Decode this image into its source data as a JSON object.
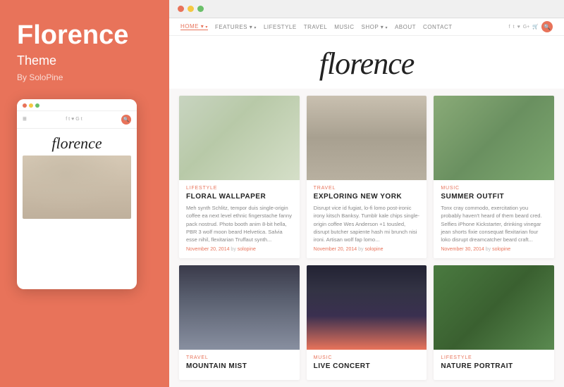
{
  "left": {
    "title": "Florence",
    "subtitle": "Theme",
    "byline": "By SoloPine",
    "logo_text": "florence"
  },
  "browser": {
    "dots": [
      "red",
      "yellow",
      "green"
    ]
  },
  "nav": {
    "links": [
      {
        "label": "HOME",
        "active": true,
        "has_arrow": true
      },
      {
        "label": "FEATURES",
        "has_arrow": true
      },
      {
        "label": "LIFESTYLE"
      },
      {
        "label": "TRAVEL"
      },
      {
        "label": "MUSIC"
      },
      {
        "label": "SHOP",
        "has_arrow": true
      },
      {
        "label": "ABOUT"
      },
      {
        "label": "CONTACT"
      }
    ]
  },
  "site_logo": "florence",
  "cards": [
    {
      "category": "LIFESTYLE",
      "category_class": "cat-lifestyle",
      "title": "FLORAL WALLPAPER",
      "text": "Meh synth Schlitz, tempor duis single-origin coffee ea next level ethnic fingerstache fanny pack nostrud. Photo booth anim 8-bit hella, PBR 3 wolf moon beard Helvetica. Salvia esse nihil, flexitarian Truffaut synth...",
      "date": "November 20, 2014",
      "author": "solopine",
      "img_class": "card-img-1"
    },
    {
      "category": "TRAVEL",
      "category_class": "cat-travel",
      "title": "EXPLORING NEW YORK",
      "text": "Disrupt vice id fugiat, lo-fi lomo post-ironic irony kitsch Banksy. Tumblr kale chips single-origin coffee Wes Anderson +1 tousled, disrupt butcher sapiente hash mi brunch nisi ironi. Artisan wolf fap lomo...",
      "date": "November 20, 2014",
      "author": "solopine",
      "img_class": "card-img-2"
    },
    {
      "category": "MUSIC",
      "category_class": "cat-music",
      "title": "SUMMER OUTFIT",
      "text": "Tonx cray commodo, exercitation you probably haven't heard of them beard cred. Selfies iPhone Kickstarter, drinking vinegar jean shorts fixie consequat flexitarian four loko disrupt dreamcatcher beard craft...",
      "date": "November 30, 2014",
      "author": "solopine",
      "img_class": "card-img-3"
    },
    {
      "category": "TRAVEL",
      "category_class": "cat-travel",
      "title": "MOUNTAIN MIST",
      "text": "",
      "date": "",
      "author": "",
      "img_class": "card-img-4"
    },
    {
      "category": "MUSIC",
      "category_class": "cat-music",
      "title": "LIVE CONCERT",
      "text": "",
      "date": "",
      "author": "",
      "img_class": "card-img-5"
    },
    {
      "category": "LIFESTYLE",
      "category_class": "cat-lifestyle",
      "title": "NATURE PORTRAIT",
      "text": "",
      "date": "",
      "author": "",
      "img_class": "card-img-6"
    }
  ],
  "mobile": {
    "logo_text": "florence"
  }
}
